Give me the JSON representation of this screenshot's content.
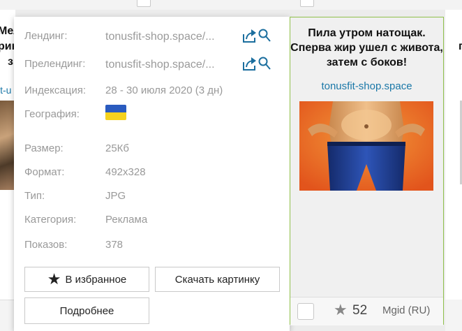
{
  "info": {
    "landing_label": "Лендинг:",
    "landing_value": "tonusfit-shop.space/...",
    "prelanding_label": "Прелендинг:",
    "prelanding_value": "tonusfit-shop.space/...",
    "indexing_label": "Индексация:",
    "indexing_value": "28 - 30 июля 2020 (3 дн)",
    "geo_label": "География:",
    "geo_flag": "ukraine-flag",
    "size_label": "Размер:",
    "size_value": "25Кб",
    "format_label": "Формат:",
    "format_value": "492x328",
    "type_label": "Тип:",
    "type_value": "JPG",
    "category_label": "Категория:",
    "category_value": "Реклама",
    "views_label": "Показов:",
    "views_value": "378"
  },
  "actions": {
    "favorite_label": "В избранное",
    "download_label": "Скачать картинку",
    "details_label": "Подробнее"
  },
  "ad": {
    "title": "Пила утром натощак. Сперва жир ушел с живота, затем с боков!",
    "domain": "tonusfit-shop.space",
    "rating": "52",
    "network": "Mgid (RU)"
  },
  "background_cards": {
    "left_title_lines": [
      "Мел",
      "рин",
      "з"
    ],
    "left_link": "it-u",
    "right_title": "п"
  },
  "colors": {
    "accent_border": "#8fc04a",
    "link": "#1b78a8",
    "flag_blue": "#2a5bbf",
    "flag_yellow": "#f5d21e"
  }
}
